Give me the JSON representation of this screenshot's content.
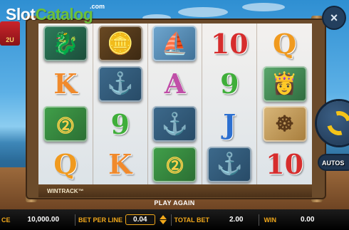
{
  "watermark": {
    "slot": "Slot",
    "catalog": "Catalog",
    "com": ".com"
  },
  "logo": {
    "text": "2U"
  },
  "reels": [
    [
      {
        "kind": "tile",
        "cls": "dragon",
        "glyph": "🐉",
        "name": "dragon"
      },
      {
        "kind": "tile",
        "cls": "chest",
        "glyph": "🪙",
        "name": "treasure-chest"
      },
      {
        "kind": "tile",
        "cls": "ship",
        "glyph": "⛵",
        "name": "junk-ship"
      },
      {
        "kind": "letter",
        "text": "10",
        "color": "#d62d2d",
        "name": "ten"
      },
      {
        "kind": "letter",
        "text": "Q",
        "color": "#f09a1f",
        "name": "queen"
      }
    ],
    [
      {
        "kind": "letter",
        "text": "K",
        "color": "#f08a2c",
        "name": "king"
      },
      {
        "kind": "tile",
        "cls": "anchor",
        "glyph": "⚓",
        "name": "anchor"
      },
      {
        "kind": "letter",
        "text": "A",
        "color": "#c04fa8",
        "name": "ace"
      },
      {
        "kind": "letter",
        "text": "9",
        "color": "#3fae3a",
        "name": "nine"
      },
      {
        "kind": "tile",
        "cls": "lady",
        "glyph": "👸",
        "name": "lady"
      }
    ],
    [
      {
        "kind": "tile",
        "cls": "wild",
        "glyph": "⓶",
        "name": "wild-2"
      },
      {
        "kind": "letter",
        "text": "9",
        "color": "#3fae3a",
        "name": "nine"
      },
      {
        "kind": "tile",
        "cls": "anchor",
        "glyph": "⚓",
        "name": "anchor"
      },
      {
        "kind": "letter",
        "text": "J",
        "color": "#2c6fd0",
        "name": "jack"
      },
      {
        "kind": "tile",
        "cls": "wheel",
        "glyph": "☸",
        "name": "ship-wheel"
      }
    ],
    [
      {
        "kind": "letter",
        "text": "Q",
        "color": "#f09a1f",
        "name": "queen"
      },
      {
        "kind": "letter",
        "text": "K",
        "color": "#f08a2c",
        "name": "king"
      },
      {
        "kind": "tile",
        "cls": "wild",
        "glyph": "⓶",
        "name": "wild-2"
      },
      {
        "kind": "tile",
        "cls": "anchor",
        "glyph": "⚓",
        "name": "anchor"
      },
      {
        "kind": "letter",
        "text": "10",
        "color": "#d62d2d",
        "name": "ten"
      }
    ]
  ],
  "wintrack": "WINTRACK™",
  "play_again": "PLAY AGAIN",
  "bar": {
    "balance_label": "CE",
    "balance_value": "10,000.00",
    "bet_per_line_label": "BET PER LINE",
    "bet_per_line_value": "0.04",
    "total_bet_label": "TOTAL BET",
    "total_bet_value": "2.00",
    "win_label": "WIN",
    "win_value": "0.00"
  },
  "controls": {
    "auto_label": "AUTOS",
    "close_glyph": "×"
  }
}
